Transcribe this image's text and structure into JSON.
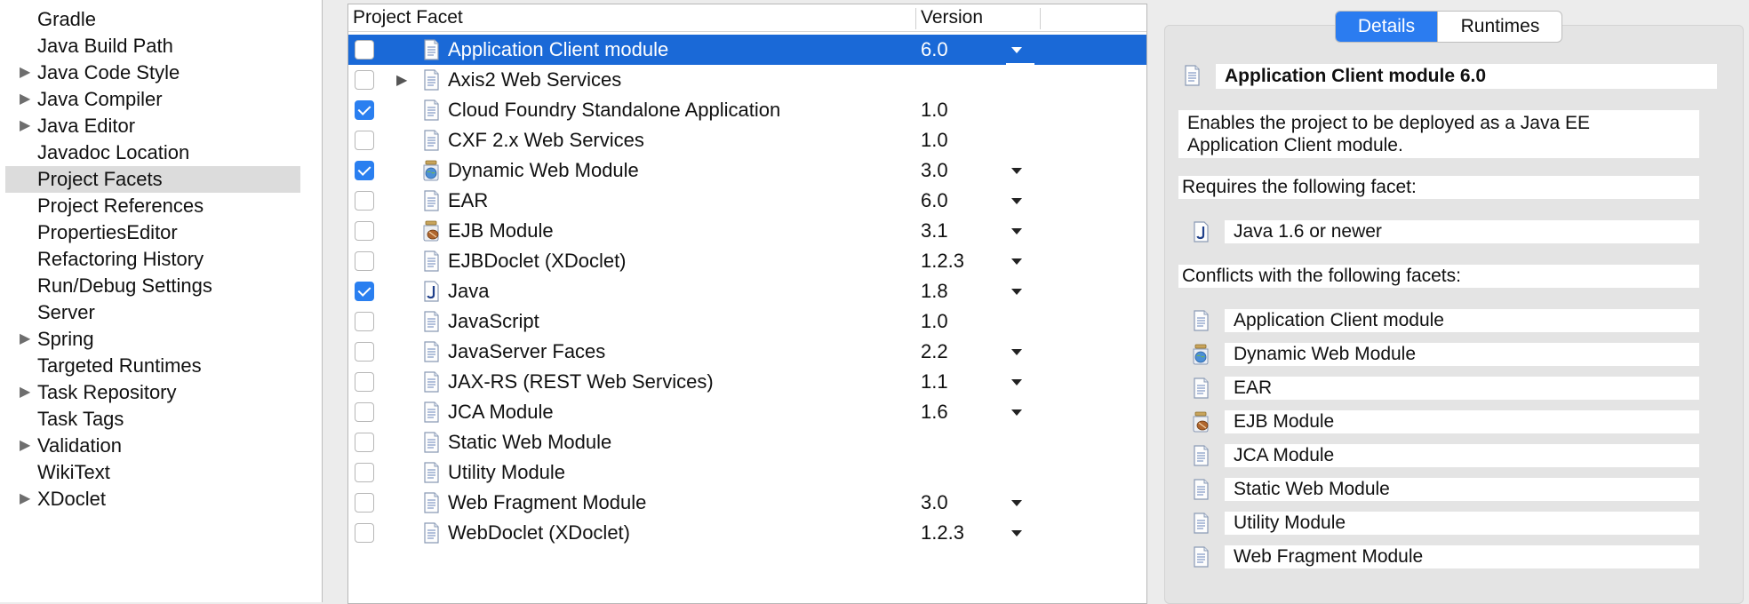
{
  "nav": {
    "items": [
      {
        "label": "Gradle",
        "expandable": false
      },
      {
        "label": "Java Build Path",
        "expandable": false
      },
      {
        "label": "Java Code Style",
        "expandable": true
      },
      {
        "label": "Java Compiler",
        "expandable": true
      },
      {
        "label": "Java Editor",
        "expandable": true
      },
      {
        "label": "Javadoc Location",
        "expandable": false
      },
      {
        "label": "Project Facets",
        "expandable": false,
        "selected": true
      },
      {
        "label": "Project References",
        "expandable": false
      },
      {
        "label": "PropertiesEditor",
        "expandable": false
      },
      {
        "label": "Refactoring History",
        "expandable": false
      },
      {
        "label": "Run/Debug Settings",
        "expandable": false
      },
      {
        "label": "Server",
        "expandable": false
      },
      {
        "label": "Spring",
        "expandable": true
      },
      {
        "label": "Targeted Runtimes",
        "expandable": false
      },
      {
        "label": "Task Repository",
        "expandable": true
      },
      {
        "label": "Task Tags",
        "expandable": false
      },
      {
        "label": "Validation",
        "expandable": true
      },
      {
        "label": "WikiText",
        "expandable": false
      },
      {
        "label": "XDoclet",
        "expandable": true
      }
    ]
  },
  "table": {
    "col_facet": "Project Facet",
    "col_version": "Version",
    "rows": [
      {
        "name": "Application Client module",
        "version": "6.0",
        "checked": false,
        "dropdown": true,
        "icon": "document-icon",
        "selected": true
      },
      {
        "name": "Axis2 Web Services",
        "version": "",
        "checked": false,
        "dropdown": false,
        "icon": "document-icon",
        "expandable": true
      },
      {
        "name": "Cloud Foundry Standalone Application",
        "version": "1.0",
        "checked": true,
        "dropdown": false,
        "icon": "document-icon"
      },
      {
        "name": "CXF 2.x Web Services",
        "version": "1.0",
        "checked": false,
        "dropdown": false,
        "icon": "document-icon"
      },
      {
        "name": "Dynamic Web Module",
        "version": "3.0",
        "checked": true,
        "dropdown": true,
        "icon": "globe-jar-icon"
      },
      {
        "name": "EAR",
        "version": "6.0",
        "checked": false,
        "dropdown": true,
        "icon": "document-icon"
      },
      {
        "name": "EJB Module",
        "version": "3.1",
        "checked": false,
        "dropdown": true,
        "icon": "bean-jar-icon"
      },
      {
        "name": "EJBDoclet (XDoclet)",
        "version": "1.2.3",
        "checked": false,
        "dropdown": true,
        "icon": "document-icon"
      },
      {
        "name": "Java",
        "version": "1.8",
        "checked": true,
        "dropdown": true,
        "icon": "java-icon"
      },
      {
        "name": "JavaScript",
        "version": "1.0",
        "checked": false,
        "dropdown": false,
        "icon": "document-icon"
      },
      {
        "name": "JavaServer Faces",
        "version": "2.2",
        "checked": false,
        "dropdown": true,
        "icon": "document-icon"
      },
      {
        "name": "JAX-RS (REST Web Services)",
        "version": "1.1",
        "checked": false,
        "dropdown": true,
        "icon": "document-icon"
      },
      {
        "name": "JCA Module",
        "version": "1.6",
        "checked": false,
        "dropdown": true,
        "icon": "document-icon"
      },
      {
        "name": "Static Web Module",
        "version": "",
        "checked": false,
        "dropdown": false,
        "icon": "document-icon"
      },
      {
        "name": "Utility Module",
        "version": "",
        "checked": false,
        "dropdown": false,
        "icon": "document-icon"
      },
      {
        "name": "Web Fragment Module",
        "version": "3.0",
        "checked": false,
        "dropdown": true,
        "icon": "document-icon"
      },
      {
        "name": "WebDoclet (XDoclet)",
        "version": "1.2.3",
        "checked": false,
        "dropdown": true,
        "icon": "document-icon"
      }
    ]
  },
  "details": {
    "tabs": [
      "Details",
      "Runtimes"
    ],
    "active_tab": "Details",
    "heading": "Application Client module 6.0",
    "description_line1": "Enables the project to be deployed as a Java EE",
    "description_line2": "Application Client module.",
    "requires_label": "Requires the following facet:",
    "requires": [
      {
        "label": "Java 1.6 or newer",
        "icon": "java-icon"
      }
    ],
    "conflicts_label": "Conflicts with the following facets:",
    "conflicts": [
      {
        "label": "Application Client module",
        "icon": "document-icon"
      },
      {
        "label": "Dynamic Web Module",
        "icon": "globe-jar-icon"
      },
      {
        "label": "EAR",
        "icon": "document-icon"
      },
      {
        "label": "EJB Module",
        "icon": "bean-jar-icon"
      },
      {
        "label": "JCA Module",
        "icon": "document-icon"
      },
      {
        "label": "Static Web Module",
        "icon": "document-icon"
      },
      {
        "label": "Utility Module",
        "icon": "document-icon"
      },
      {
        "label": "Web Fragment Module",
        "icon": "document-icon"
      }
    ]
  },
  "colors": {
    "selection": "#1a69d7",
    "accent": "#2b7cf0",
    "check": "#2a7ff0"
  }
}
